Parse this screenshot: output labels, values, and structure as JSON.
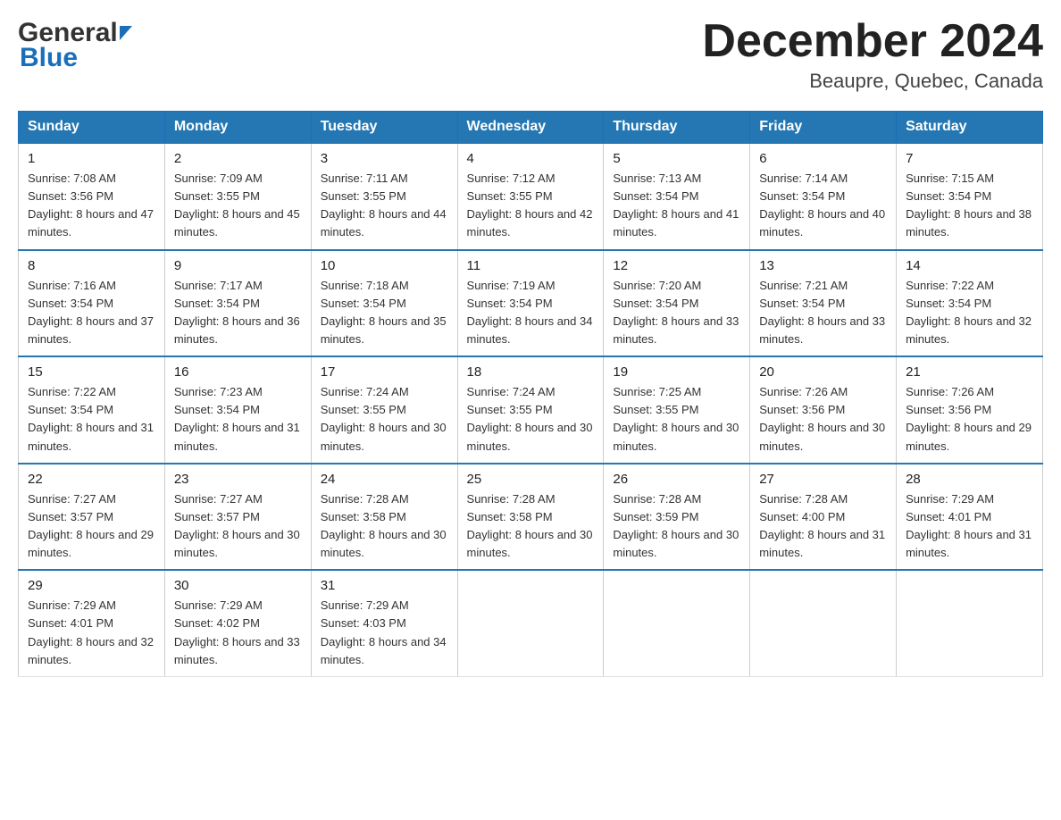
{
  "header": {
    "month_title": "December 2024",
    "location": "Beaupre, Quebec, Canada"
  },
  "days_of_week": [
    "Sunday",
    "Monday",
    "Tuesday",
    "Wednesday",
    "Thursday",
    "Friday",
    "Saturday"
  ],
  "weeks": [
    [
      {
        "day": "1",
        "sunrise": "7:08 AM",
        "sunset": "3:56 PM",
        "daylight": "8 hours and 47 minutes."
      },
      {
        "day": "2",
        "sunrise": "7:09 AM",
        "sunset": "3:55 PM",
        "daylight": "8 hours and 45 minutes."
      },
      {
        "day": "3",
        "sunrise": "7:11 AM",
        "sunset": "3:55 PM",
        "daylight": "8 hours and 44 minutes."
      },
      {
        "day": "4",
        "sunrise": "7:12 AM",
        "sunset": "3:55 PM",
        "daylight": "8 hours and 42 minutes."
      },
      {
        "day": "5",
        "sunrise": "7:13 AM",
        "sunset": "3:54 PM",
        "daylight": "8 hours and 41 minutes."
      },
      {
        "day": "6",
        "sunrise": "7:14 AM",
        "sunset": "3:54 PM",
        "daylight": "8 hours and 40 minutes."
      },
      {
        "day": "7",
        "sunrise": "7:15 AM",
        "sunset": "3:54 PM",
        "daylight": "8 hours and 38 minutes."
      }
    ],
    [
      {
        "day": "8",
        "sunrise": "7:16 AM",
        "sunset": "3:54 PM",
        "daylight": "8 hours and 37 minutes."
      },
      {
        "day": "9",
        "sunrise": "7:17 AM",
        "sunset": "3:54 PM",
        "daylight": "8 hours and 36 minutes."
      },
      {
        "day": "10",
        "sunrise": "7:18 AM",
        "sunset": "3:54 PM",
        "daylight": "8 hours and 35 minutes."
      },
      {
        "day": "11",
        "sunrise": "7:19 AM",
        "sunset": "3:54 PM",
        "daylight": "8 hours and 34 minutes."
      },
      {
        "day": "12",
        "sunrise": "7:20 AM",
        "sunset": "3:54 PM",
        "daylight": "8 hours and 33 minutes."
      },
      {
        "day": "13",
        "sunrise": "7:21 AM",
        "sunset": "3:54 PM",
        "daylight": "8 hours and 33 minutes."
      },
      {
        "day": "14",
        "sunrise": "7:22 AM",
        "sunset": "3:54 PM",
        "daylight": "8 hours and 32 minutes."
      }
    ],
    [
      {
        "day": "15",
        "sunrise": "7:22 AM",
        "sunset": "3:54 PM",
        "daylight": "8 hours and 31 minutes."
      },
      {
        "day": "16",
        "sunrise": "7:23 AM",
        "sunset": "3:54 PM",
        "daylight": "8 hours and 31 minutes."
      },
      {
        "day": "17",
        "sunrise": "7:24 AM",
        "sunset": "3:55 PM",
        "daylight": "8 hours and 30 minutes."
      },
      {
        "day": "18",
        "sunrise": "7:24 AM",
        "sunset": "3:55 PM",
        "daylight": "8 hours and 30 minutes."
      },
      {
        "day": "19",
        "sunrise": "7:25 AM",
        "sunset": "3:55 PM",
        "daylight": "8 hours and 30 minutes."
      },
      {
        "day": "20",
        "sunrise": "7:26 AM",
        "sunset": "3:56 PM",
        "daylight": "8 hours and 30 minutes."
      },
      {
        "day": "21",
        "sunrise": "7:26 AM",
        "sunset": "3:56 PM",
        "daylight": "8 hours and 29 minutes."
      }
    ],
    [
      {
        "day": "22",
        "sunrise": "7:27 AM",
        "sunset": "3:57 PM",
        "daylight": "8 hours and 29 minutes."
      },
      {
        "day": "23",
        "sunrise": "7:27 AM",
        "sunset": "3:57 PM",
        "daylight": "8 hours and 30 minutes."
      },
      {
        "day": "24",
        "sunrise": "7:28 AM",
        "sunset": "3:58 PM",
        "daylight": "8 hours and 30 minutes."
      },
      {
        "day": "25",
        "sunrise": "7:28 AM",
        "sunset": "3:58 PM",
        "daylight": "8 hours and 30 minutes."
      },
      {
        "day": "26",
        "sunrise": "7:28 AM",
        "sunset": "3:59 PM",
        "daylight": "8 hours and 30 minutes."
      },
      {
        "day": "27",
        "sunrise": "7:28 AM",
        "sunset": "4:00 PM",
        "daylight": "8 hours and 31 minutes."
      },
      {
        "day": "28",
        "sunrise": "7:29 AM",
        "sunset": "4:01 PM",
        "daylight": "8 hours and 31 minutes."
      }
    ],
    [
      {
        "day": "29",
        "sunrise": "7:29 AM",
        "sunset": "4:01 PM",
        "daylight": "8 hours and 32 minutes."
      },
      {
        "day": "30",
        "sunrise": "7:29 AM",
        "sunset": "4:02 PM",
        "daylight": "8 hours and 33 minutes."
      },
      {
        "day": "31",
        "sunrise": "7:29 AM",
        "sunset": "4:03 PM",
        "daylight": "8 hours and 34 minutes."
      },
      null,
      null,
      null,
      null
    ]
  ]
}
